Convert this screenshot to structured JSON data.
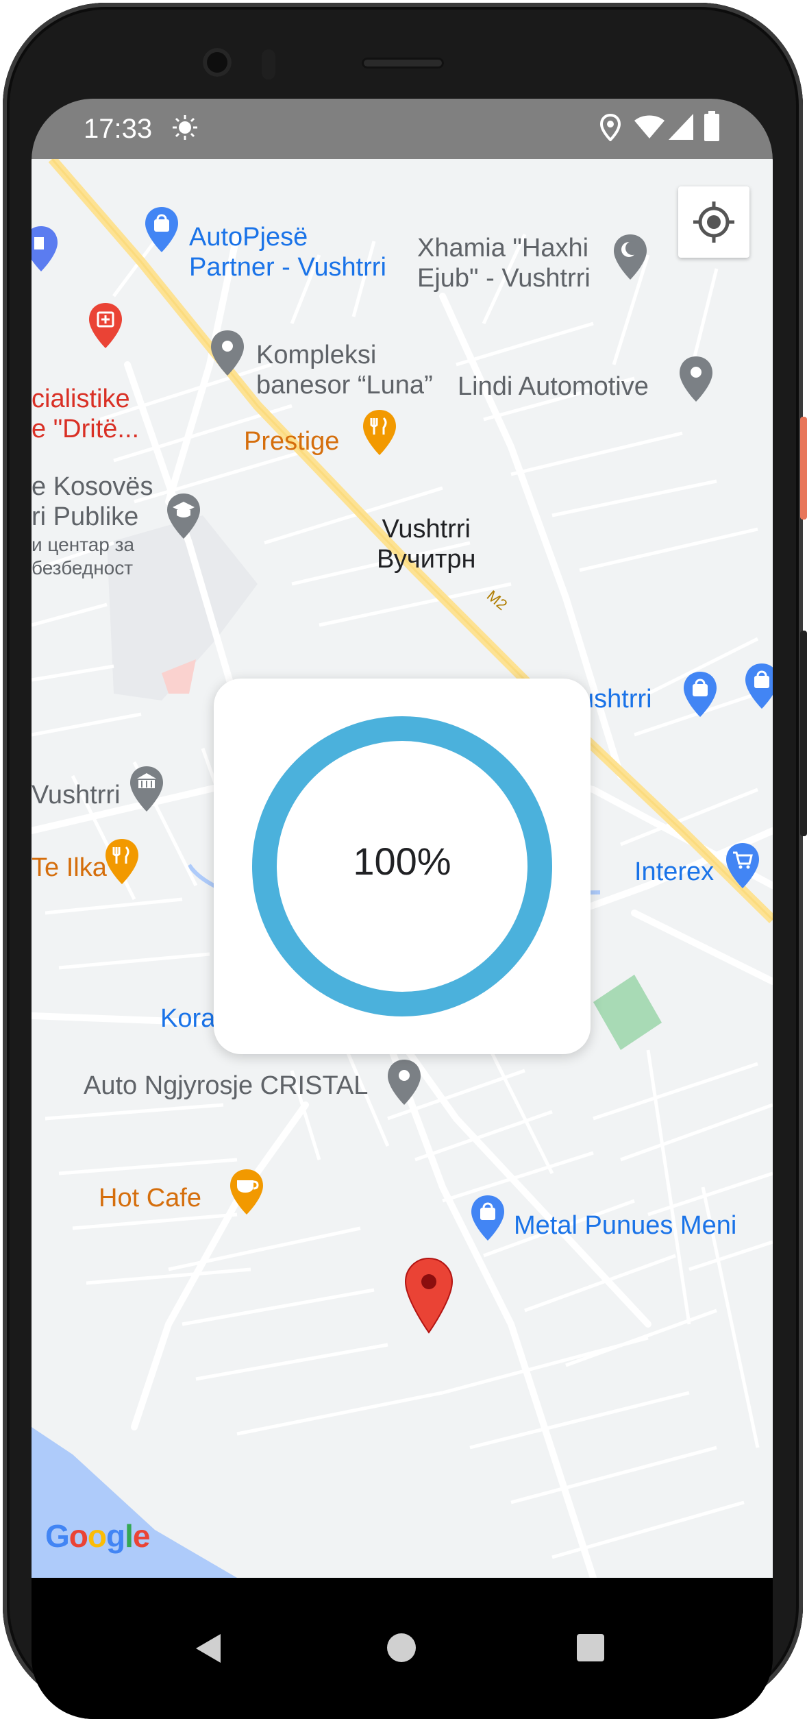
{
  "status_bar": {
    "time": "17:33",
    "icons": [
      "brightness-icon",
      "location-icon",
      "wifi-icon",
      "cell-signal-icon",
      "battery-icon"
    ]
  },
  "map": {
    "labels": {
      "autopjese": "AutoPjesë\nPartner - Vushtrri",
      "xhamia": "Xhamia \"Haxhi\nEjub\" - Vushtrri",
      "kompleksi": "Kompleksi\nbanesor “Luna”",
      "lindi": "Lindi Automotive",
      "specialistike": "cialistike\ne \"Dritë...",
      "prestige": "Prestige",
      "kosoves": "e Kosovës\nri Publike",
      "centar": "и центар за\nбезбедност",
      "city": "Vushtrri\nВучитрн",
      "vushtrri_store": "ushtrri",
      "vushtrri_museum": "Vushtrri",
      "te_ilka": "Te Ilka",
      "interex": "Interex",
      "kora": "Kora",
      "auto_ngjyrosje": "Auto Ngjyrosje CRISTAL",
      "hot_cafe": "Hot Cafe",
      "metal": "Metal Punues Meni",
      "road": "M2",
      "google": [
        "G",
        "o",
        "o",
        "g",
        "l",
        "e"
      ]
    },
    "google_colors": [
      "#4285f4",
      "#ea4335",
      "#fbbc05",
      "#4285f4",
      "#34a853",
      "#ea4335"
    ],
    "my_location_button": "my-location-icon"
  },
  "progress_dialog": {
    "value": 1.0,
    "text": "100%",
    "ring_color": "#4bb1dc"
  },
  "nav_bar": {
    "back": "back-icon",
    "home": "home-icon",
    "recents": "recents-icon"
  }
}
